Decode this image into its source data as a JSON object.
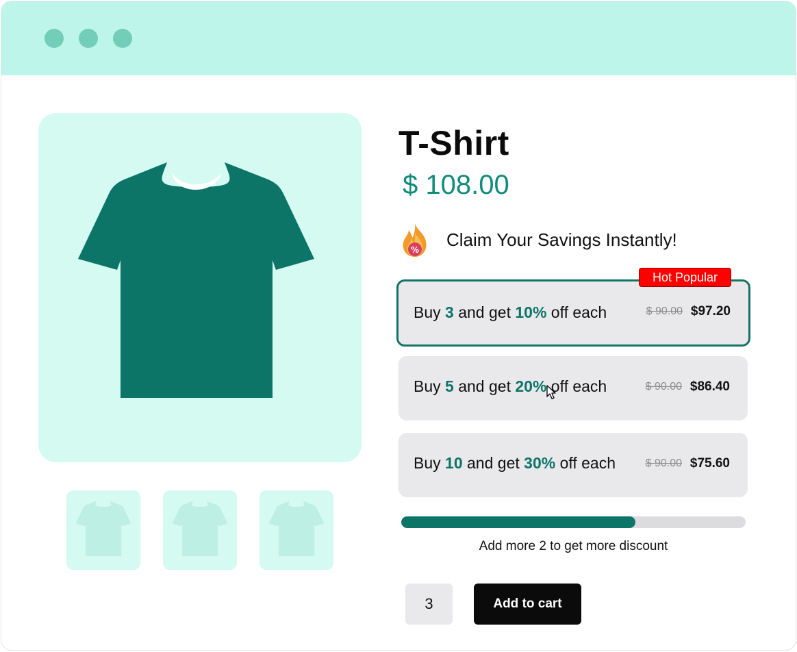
{
  "window": {
    "controls": [
      "close-dot",
      "minimize-dot",
      "maximize-dot"
    ]
  },
  "product": {
    "title": "T-Shirt",
    "price": "$ 108.00",
    "image_icon": "tshirt-icon",
    "image_color": "#0c7567",
    "thumbnail_count": 3
  },
  "promo": {
    "icon": "fire-percent-icon",
    "headline": "Claim Your Savings Instantly!"
  },
  "offers": [
    {
      "prefix": "Buy ",
      "qty": "3",
      "middle": " and get ",
      "discount": "10%",
      "suffix": " off each",
      "old_price": "$ 90.00",
      "new_price": "$97.20",
      "selected": true,
      "badge": "Hot Popular"
    },
    {
      "prefix": "Buy ",
      "qty": "5",
      "middle": " and get ",
      "discount": "20%",
      "suffix": " off each",
      "old_price": "$ 90.00",
      "new_price": "$86.40",
      "selected": false
    },
    {
      "prefix": "Buy ",
      "qty": "10",
      "middle": " and get ",
      "discount": "30%",
      "suffix": " off each",
      "old_price": "$ 90.00",
      "new_price": "$75.60",
      "selected": false
    }
  ],
  "progress": {
    "fraction": 0.68,
    "text": "Add more 2 to get more discount"
  },
  "cart": {
    "quantity": "3",
    "button_label": "Add to cart"
  },
  "colors": {
    "accent": "#0c7567",
    "titlebar": "#bdf5ea",
    "image_bg": "#d4faf1",
    "badge": "#ff0000"
  }
}
